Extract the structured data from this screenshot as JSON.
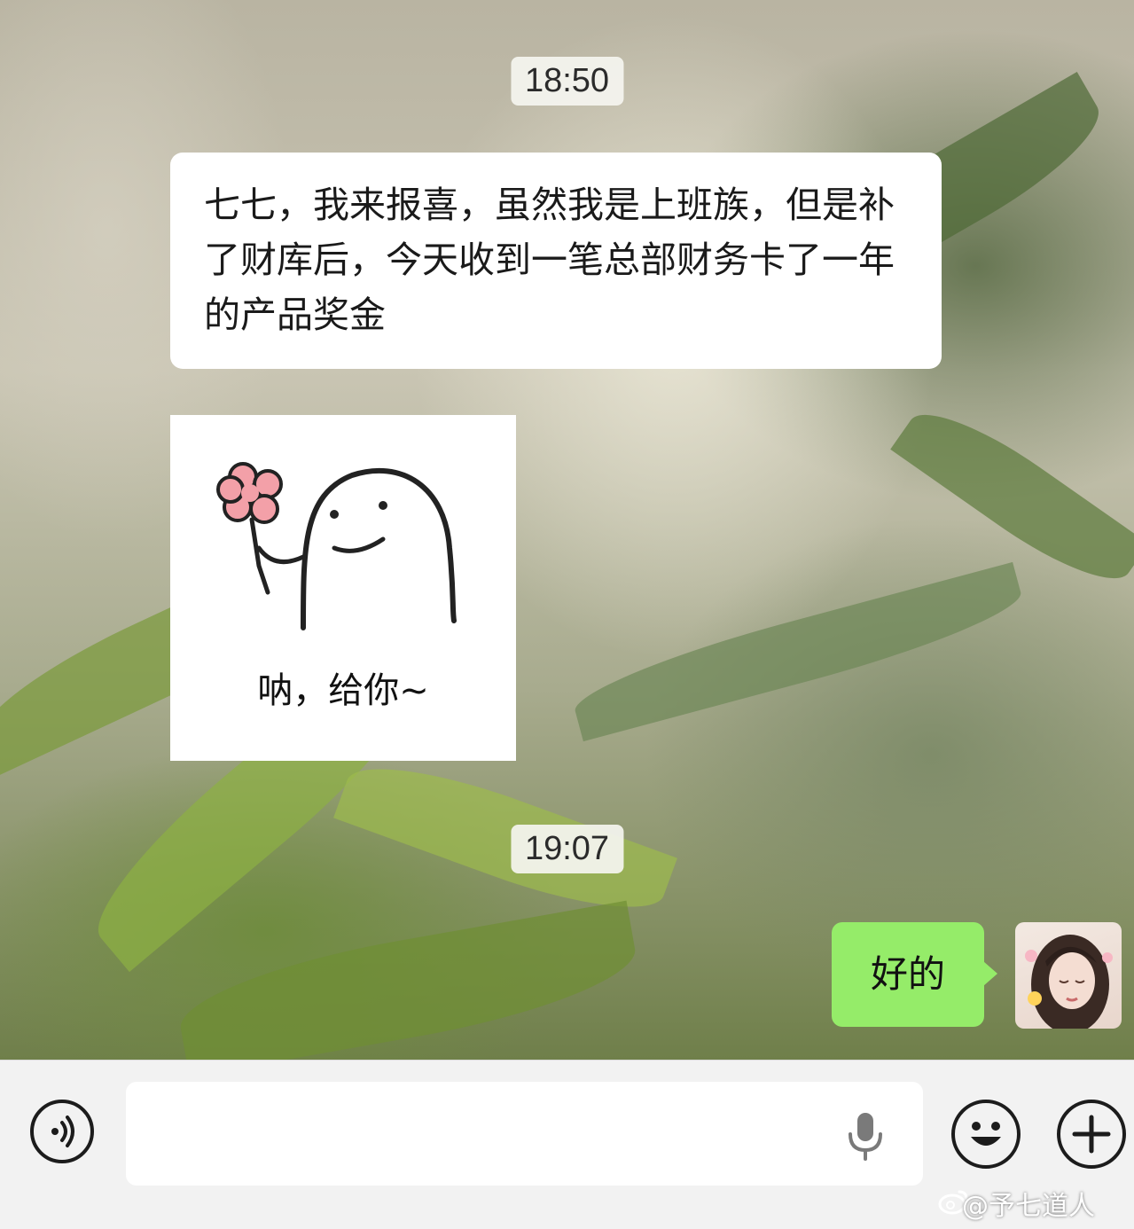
{
  "chat": {
    "timestamp_1": "18:50",
    "incoming_message": "七七，我来报喜，虽然我是上班族，但是补了财库后，今天收到一笔总部财务卡了一年的产品奖金",
    "sticker_caption": "呐，给你~",
    "timestamp_2": "19:07",
    "outgoing_message": "好的"
  },
  "input_bar": {
    "text_value": ""
  },
  "watermark": "@予七道人",
  "colors": {
    "outgoing_bubble": "#95ec69",
    "incoming_bubble": "#ffffff",
    "input_bar_bg": "#f2f2f2"
  },
  "icons": [
    "voice-icon",
    "microphone-icon",
    "emoji-icon",
    "plus-icon",
    "weibo-logo-icon"
  ]
}
